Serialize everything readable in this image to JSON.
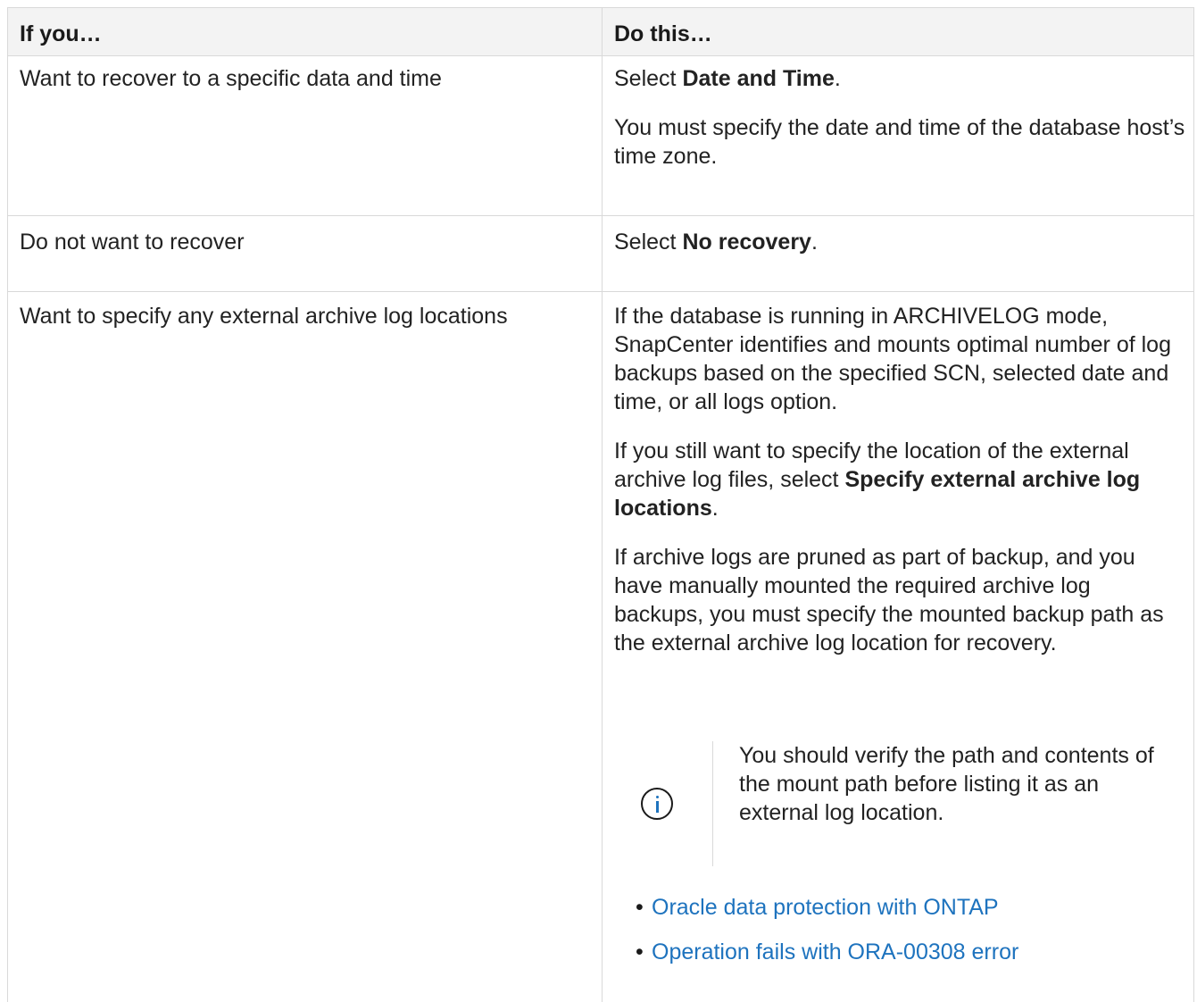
{
  "table": {
    "header": {
      "col1": "If you…",
      "col2": "Do this…"
    },
    "rows": [
      {
        "if": "Want to recover to a specific data and time",
        "do_pre": "Select ",
        "do_bold": "Date and Time",
        "do_post": ".",
        "do_extra": "You must specify the date and time of the database host’s time zone."
      },
      {
        "if": "Do not want to recover",
        "do_pre": "Select ",
        "do_bold": "No recovery",
        "do_post": "."
      },
      {
        "if": "Want to specify any external archive log locations",
        "p1": "If the database is running in ARCHIVELOG mode, SnapCenter identifies and mounts optimal number of log backups based on the specified SCN, selected date and time, or all logs option.",
        "p2_pre": "If you still want to specify the location of the external archive log files, select ",
        "p2_bold": "Specify external archive log locations",
        "p2_post": ".",
        "p3": "If archive logs are pruned as part of backup, and you have manually mounted the required archive log backups, you must specify the mounted backup path as the external archive log location for recovery.",
        "note": {
          "icon": "info-icon",
          "text": "You should verify the path and contents of the mount path before listing it as an external log location."
        },
        "links": [
          {
            "label": "Oracle data protection with ONTAP"
          },
          {
            "label": "Operation fails with ORA-00308 error"
          }
        ]
      }
    ]
  },
  "colors": {
    "link": "#1e73be",
    "border": "#d9d9d9",
    "header_bg": "#f3f3f3"
  }
}
